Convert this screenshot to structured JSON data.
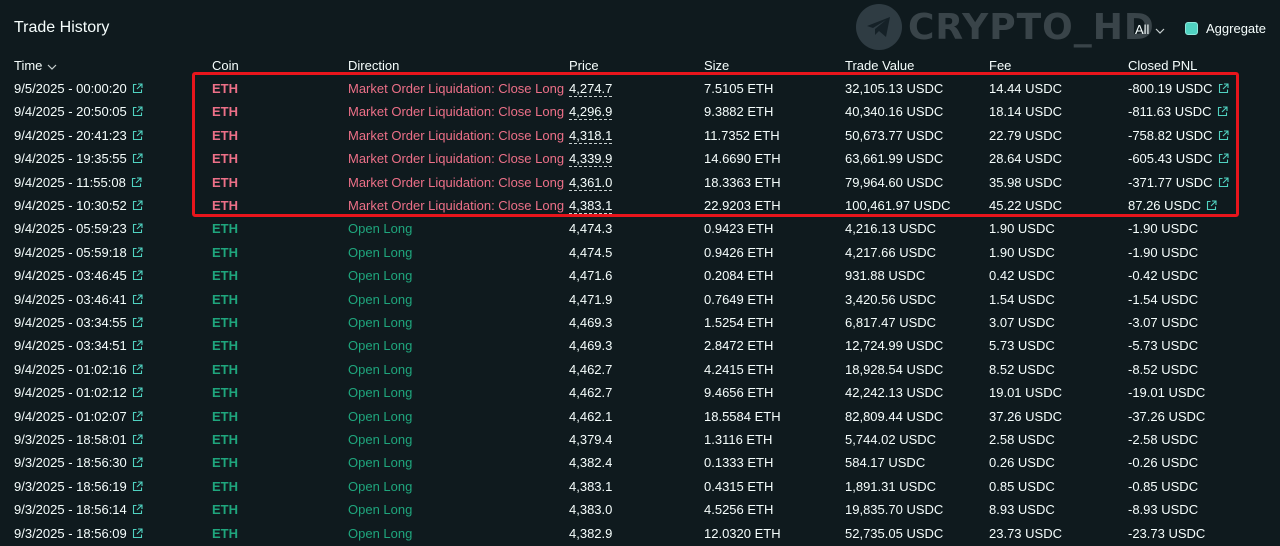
{
  "header": {
    "title": "Trade History",
    "watermark": "CRYPTO_HD",
    "filter_value": "All",
    "aggregate_label": "Aggregate",
    "aggregate_checked": true
  },
  "columns": {
    "time": "Time",
    "coin": "Coin",
    "direction": "Direction",
    "price": "Price",
    "size": "Size",
    "trade_value": "Trade Value",
    "fee": "Fee",
    "closed_pnl": "Closed PNL"
  },
  "colors": {
    "background": "#0f1a1e",
    "text": "#f6fefd",
    "close_red": "#ed7088",
    "open_green": "#1fa67d",
    "coin_green": "#1fa67d",
    "checkbox_teal": "#50d2c1",
    "highlight_border": "#e8151c",
    "link_icon": "#50d2c1"
  },
  "rows": [
    {
      "time": "9/5/2025 - 00:00:20",
      "coin": "ETH",
      "direction": "Market Order Liquidation: Close Long",
      "price": "4,274.7",
      "size": "7.5105 ETH",
      "trade_value": "32,105.13 USDC",
      "fee": "14.44 USDC",
      "closed_pnl": "-800.19 USDC",
      "liquidation": true
    },
    {
      "time": "9/4/2025 - 20:50:05",
      "coin": "ETH",
      "direction": "Market Order Liquidation: Close Long",
      "price": "4,296.9",
      "size": "9.3882 ETH",
      "trade_value": "40,340.16 USDC",
      "fee": "18.14 USDC",
      "closed_pnl": "-811.63 USDC",
      "liquidation": true
    },
    {
      "time": "9/4/2025 - 20:41:23",
      "coin": "ETH",
      "direction": "Market Order Liquidation: Close Long",
      "price": "4,318.1",
      "size": "11.7352 ETH",
      "trade_value": "50,673.77 USDC",
      "fee": "22.79 USDC",
      "closed_pnl": "-758.82 USDC",
      "liquidation": true
    },
    {
      "time": "9/4/2025 - 19:35:55",
      "coin": "ETH",
      "direction": "Market Order Liquidation: Close Long",
      "price": "4,339.9",
      "size": "14.6690 ETH",
      "trade_value": "63,661.99 USDC",
      "fee": "28.64 USDC",
      "closed_pnl": "-605.43 USDC",
      "liquidation": true
    },
    {
      "time": "9/4/2025 - 11:55:08",
      "coin": "ETH",
      "direction": "Market Order Liquidation: Close Long",
      "price": "4,361.0",
      "size": "18.3363 ETH",
      "trade_value": "79,964.60 USDC",
      "fee": "35.98 USDC",
      "closed_pnl": "-371.77 USDC",
      "liquidation": true
    },
    {
      "time": "9/4/2025 - 10:30:52",
      "coin": "ETH",
      "direction": "Market Order Liquidation: Close Long",
      "price": "4,383.1",
      "size": "22.9203 ETH",
      "trade_value": "100,461.97 USDC",
      "fee": "45.22 USDC",
      "closed_pnl": "87.26 USDC",
      "liquidation": true
    },
    {
      "time": "9/4/2025 - 05:59:23",
      "coin": "ETH",
      "direction": "Open Long",
      "price": "4,474.3",
      "size": "0.9423 ETH",
      "trade_value": "4,216.13 USDC",
      "fee": "1.90 USDC",
      "closed_pnl": "-1.90 USDC",
      "liquidation": false
    },
    {
      "time": "9/4/2025 - 05:59:18",
      "coin": "ETH",
      "direction": "Open Long",
      "price": "4,474.5",
      "size": "0.9426 ETH",
      "trade_value": "4,217.66 USDC",
      "fee": "1.90 USDC",
      "closed_pnl": "-1.90 USDC",
      "liquidation": false
    },
    {
      "time": "9/4/2025 - 03:46:45",
      "coin": "ETH",
      "direction": "Open Long",
      "price": "4,471.6",
      "size": "0.2084 ETH",
      "trade_value": "931.88 USDC",
      "fee": "0.42 USDC",
      "closed_pnl": "-0.42 USDC",
      "liquidation": false
    },
    {
      "time": "9/4/2025 - 03:46:41",
      "coin": "ETH",
      "direction": "Open Long",
      "price": "4,471.9",
      "size": "0.7649 ETH",
      "trade_value": "3,420.56 USDC",
      "fee": "1.54 USDC",
      "closed_pnl": "-1.54 USDC",
      "liquidation": false
    },
    {
      "time": "9/4/2025 - 03:34:55",
      "coin": "ETH",
      "direction": "Open Long",
      "price": "4,469.3",
      "size": "1.5254 ETH",
      "trade_value": "6,817.47 USDC",
      "fee": "3.07 USDC",
      "closed_pnl": "-3.07 USDC",
      "liquidation": false
    },
    {
      "time": "9/4/2025 - 03:34:51",
      "coin": "ETH",
      "direction": "Open Long",
      "price": "4,469.3",
      "size": "2.8472 ETH",
      "trade_value": "12,724.99 USDC",
      "fee": "5.73 USDC",
      "closed_pnl": "-5.73 USDC",
      "liquidation": false
    },
    {
      "time": "9/4/2025 - 01:02:16",
      "coin": "ETH",
      "direction": "Open Long",
      "price": "4,462.7",
      "size": "4.2415 ETH",
      "trade_value": "18,928.54 USDC",
      "fee": "8.52 USDC",
      "closed_pnl": "-8.52 USDC",
      "liquidation": false
    },
    {
      "time": "9/4/2025 - 01:02:12",
      "coin": "ETH",
      "direction": "Open Long",
      "price": "4,462.7",
      "size": "9.4656 ETH",
      "trade_value": "42,242.13 USDC",
      "fee": "19.01 USDC",
      "closed_pnl": "-19.01 USDC",
      "liquidation": false
    },
    {
      "time": "9/4/2025 - 01:02:07",
      "coin": "ETH",
      "direction": "Open Long",
      "price": "4,462.1",
      "size": "18.5584 ETH",
      "trade_value": "82,809.44 USDC",
      "fee": "37.26 USDC",
      "closed_pnl": "-37.26 USDC",
      "liquidation": false
    },
    {
      "time": "9/3/2025 - 18:58:01",
      "coin": "ETH",
      "direction": "Open Long",
      "price": "4,379.4",
      "size": "1.3116 ETH",
      "trade_value": "5,744.02 USDC",
      "fee": "2.58 USDC",
      "closed_pnl": "-2.58 USDC",
      "liquidation": false
    },
    {
      "time": "9/3/2025 - 18:56:30",
      "coin": "ETH",
      "direction": "Open Long",
      "price": "4,382.4",
      "size": "0.1333 ETH",
      "trade_value": "584.17 USDC",
      "fee": "0.26 USDC",
      "closed_pnl": "-0.26 USDC",
      "liquidation": false
    },
    {
      "time": "9/3/2025 - 18:56:19",
      "coin": "ETH",
      "direction": "Open Long",
      "price": "4,383.1",
      "size": "0.4315 ETH",
      "trade_value": "1,891.31 USDC",
      "fee": "0.85 USDC",
      "closed_pnl": "-0.85 USDC",
      "liquidation": false
    },
    {
      "time": "9/3/2025 - 18:56:14",
      "coin": "ETH",
      "direction": "Open Long",
      "price": "4,383.0",
      "size": "4.5256 ETH",
      "trade_value": "19,835.70 USDC",
      "fee": "8.93 USDC",
      "closed_pnl": "-8.93 USDC",
      "liquidation": false
    },
    {
      "time": "9/3/2025 - 18:56:09",
      "coin": "ETH",
      "direction": "Open Long",
      "price": "4,382.9",
      "size": "12.0320 ETH",
      "trade_value": "52,735.05 USDC",
      "fee": "23.73 USDC",
      "closed_pnl": "-23.73 USDC",
      "liquidation": false
    }
  ]
}
